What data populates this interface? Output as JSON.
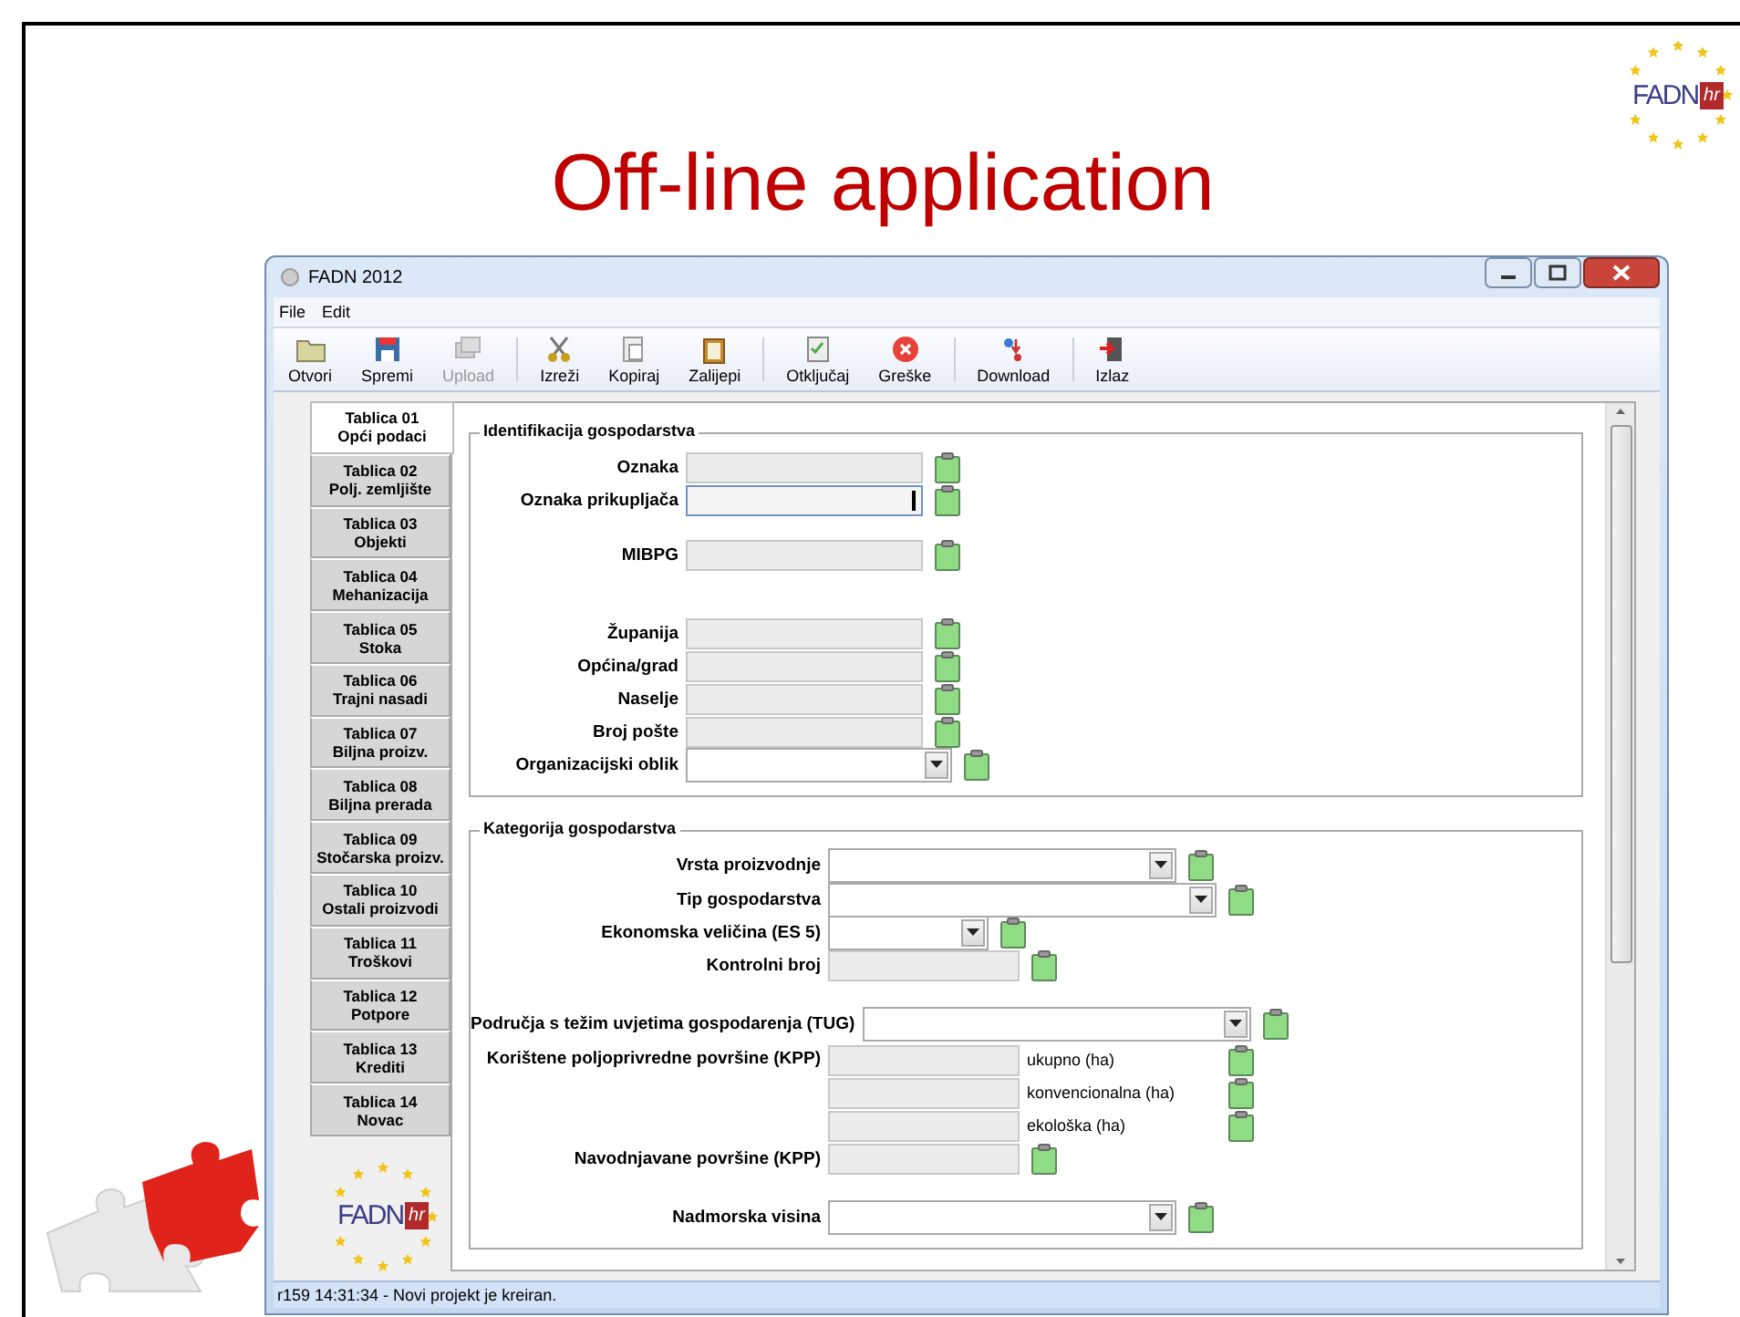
{
  "slide": {
    "title": "Off-line application",
    "logo": {
      "text": "FADN",
      "suffix": "hr"
    }
  },
  "window": {
    "title": "FADN 2012",
    "menu": [
      "File",
      "Edit"
    ],
    "toolbar": [
      {
        "label": "Otvori",
        "disabled": false
      },
      {
        "label": "Spremi",
        "disabled": false
      },
      {
        "label": "Upload",
        "disabled": true
      },
      {
        "label": "Izreži",
        "disabled": false
      },
      {
        "label": "Kopiraj",
        "disabled": false
      },
      {
        "label": "Zalijepi",
        "disabled": false
      },
      {
        "label": "Otključaj",
        "disabled": false
      },
      {
        "label": "Greške",
        "disabled": false
      },
      {
        "label": "Download",
        "disabled": false
      },
      {
        "label": "Izlaz",
        "disabled": false
      }
    ],
    "tabs": [
      {
        "number": "Tablica 01",
        "name": "Opći podaci",
        "selected": true
      },
      {
        "number": "Tablica 02",
        "name": "Polj. zemljište",
        "selected": false
      },
      {
        "number": "Tablica 03",
        "name": "Objekti",
        "selected": false
      },
      {
        "number": "Tablica 04",
        "name": "Mehanizacija",
        "selected": false
      },
      {
        "number": "Tablica 05",
        "name": "Stoka",
        "selected": false
      },
      {
        "number": "Tablica 06",
        "name": "Trajni nasadi",
        "selected": false
      },
      {
        "number": "Tablica 07",
        "name": "Biljna proizv.",
        "selected": false
      },
      {
        "number": "Tablica 08",
        "name": "Biljna prerada",
        "selected": false
      },
      {
        "number": "Tablica 09",
        "name": "Stočarska proizv.",
        "selected": false
      },
      {
        "number": "Tablica 10",
        "name": "Ostali proizvodi",
        "selected": false
      },
      {
        "number": "Tablica 11",
        "name": "Troškovi",
        "selected": false
      },
      {
        "number": "Tablica 12",
        "name": "Potpore",
        "selected": false
      },
      {
        "number": "Tablica 13",
        "name": "Krediti",
        "selected": false
      },
      {
        "number": "Tablica 14",
        "name": "Novac",
        "selected": false
      }
    ],
    "sidebar_logo": {
      "text": "FADN",
      "suffix": "hr"
    },
    "groups": [
      {
        "title": "Identifikacija gospodarstva",
        "rows": [
          {
            "label": "Oznaka",
            "kind": "text",
            "focused": false
          },
          {
            "label": "Oznaka prikupljača",
            "kind": "text",
            "focused": true
          },
          {
            "label": "MIBPG",
            "kind": "text",
            "focused": false
          },
          {
            "label": "Županija",
            "kind": "text",
            "focused": false
          },
          {
            "label": "Općina/grad",
            "kind": "text",
            "focused": false
          },
          {
            "label": "Naselje",
            "kind": "text",
            "focused": false
          },
          {
            "label": "Broj pošte",
            "kind": "text",
            "focused": false
          },
          {
            "label": "Organizacijski oblik",
            "kind": "combo"
          }
        ]
      },
      {
        "title": "Kategorija gospodarstva",
        "rows": [
          {
            "label": "Vrsta proizvodnje",
            "kind": "combo"
          },
          {
            "label": "Tip gospodarstva",
            "kind": "combo"
          },
          {
            "label": "Ekonomska veličina (ES 5)",
            "kind": "combo"
          },
          {
            "label": "Kontrolni broj",
            "kind": "text",
            "focused": false
          },
          {
            "label": "Područja s težim uvjetima gospodarenja (TUG)",
            "kind": "combo"
          },
          {
            "label": "Korištene poljoprivredne površine (KPP)",
            "kind": "multi",
            "fields": [
              {
                "unit": "ukupno (ha)"
              },
              {
                "unit": "konvencionalna (ha)"
              },
              {
                "unit": "ekološka (ha)"
              }
            ]
          },
          {
            "label": "Navodnjavane površine (KPP)",
            "kind": "text",
            "focused": false
          },
          {
            "label": "Nadmorska visina",
            "kind": "combo"
          }
        ]
      }
    ],
    "status_bar": "r159 14:31:34 - Novi projekt je kreiran."
  }
}
